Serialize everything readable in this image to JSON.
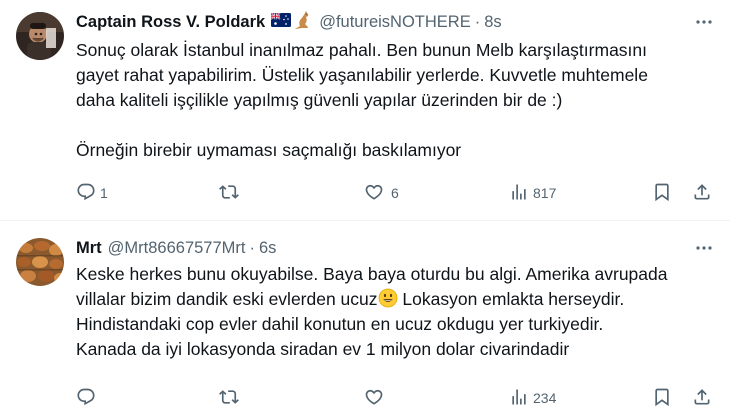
{
  "tweets": [
    {
      "name": "Captain Ross V. Poldark",
      "handle": "@futureisNOTHERE",
      "separator": "·",
      "time": "8s",
      "lines": [
        "Sonuç olarak İstanbul inanılmaz pahalı. Ben bunun Melb karşılaştırmasını",
        "gayet rahat yapabilirim. Üstelik yaşanılabilir yerlerde. Kuvvetle muhtemele",
        "daha kaliteli işçilikle yapılmış güvenli yapılar üzerinden bir de :)",
        "Örneğin birebir uymaması saçmalığı baskılamıyor"
      ],
      "counts": {
        "replies": "1",
        "retweets": "",
        "likes": "6",
        "views": "817"
      }
    },
    {
      "name": "Mrt",
      "handle": "@Mrt86667577Mrt",
      "separator": "·",
      "time": "6s",
      "lines": [
        "Keske herkes bunu okuyabilse. Baya baya oturdu bu algi. Amerika avrupada",
        "villalar bizim dandik eski evlerden ucuz",
        " Lokasyon emlakta herseydir.",
        "Hindistandaki cop evler dahil konutun en ucuz okdugu yer turkiyedir.",
        "Kanada da iyi lokasyonda siradan ev 1 milyon dolar civarindadir"
      ],
      "counts": {
        "replies": "",
        "retweets": "",
        "likes": "",
        "views": "234"
      }
    }
  ],
  "icons": [
    "more-icon",
    "reply-icon",
    "retweet-icon",
    "like-icon",
    "views-icon",
    "bookmark-icon",
    "share-icon",
    "australia-flag-icon",
    "kangaroo-icon",
    "smiling-face-emoji"
  ],
  "colors": {
    "text": "#0f1419",
    "muted": "#536471",
    "divider": "#eff3f4"
  }
}
